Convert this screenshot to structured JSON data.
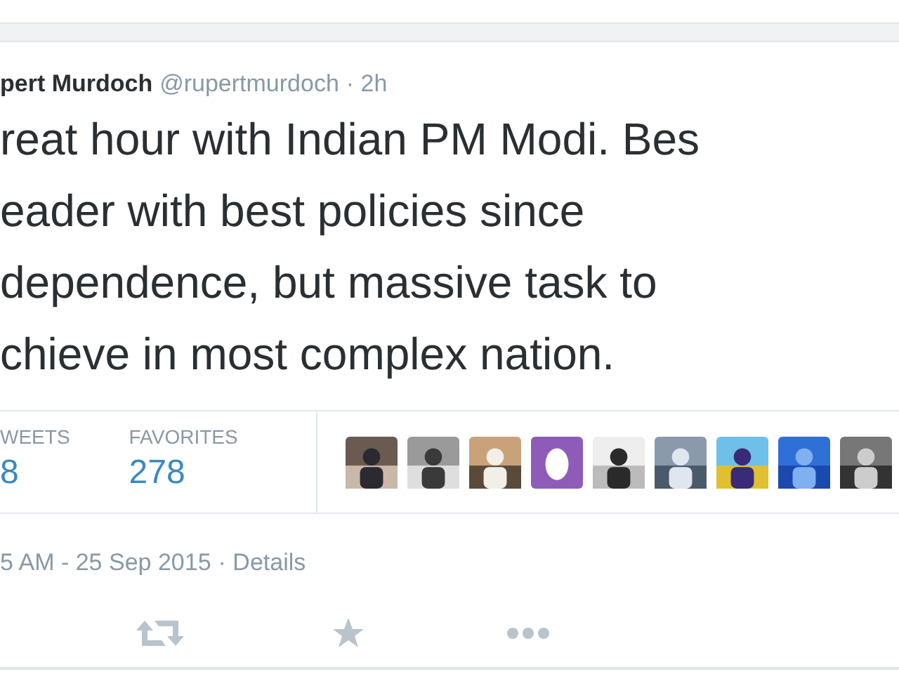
{
  "tweet": {
    "name": "pert Murdoch",
    "handle": "@rupertmurdoch",
    "time": "· 2h",
    "lines": [
      "reat hour with Indian PM Modi. Bes",
      "eader with best policies since",
      "dependence, but massive task to",
      "chieve in most complex nation."
    ],
    "stats": [
      {
        "label": "WEETS",
        "value": "8"
      },
      {
        "label": "FAVORITES",
        "value": "278"
      }
    ],
    "avatars": [
      {
        "kind": "picture"
      },
      {
        "kind": "picture"
      },
      {
        "kind": "picture"
      },
      {
        "kind": "egg"
      },
      {
        "kind": "picture"
      },
      {
        "kind": "picture"
      },
      {
        "kind": "picture"
      },
      {
        "kind": "picture"
      },
      {
        "kind": "picture"
      }
    ],
    "date": "5 AM - 25 Sep 2015",
    "details": "· Details"
  }
}
